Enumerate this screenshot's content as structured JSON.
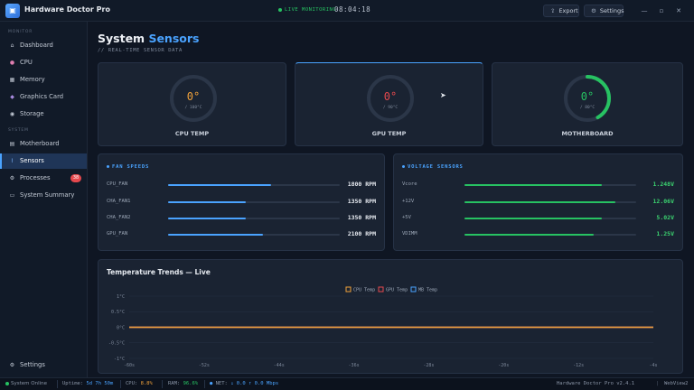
{
  "app": {
    "title": "Hardware Doctor Pro",
    "logo_icon": "chip-icon"
  },
  "titlebar": {
    "live_text": "LIVE MONITORING",
    "clock": "08:04:18",
    "export_label": "Export",
    "settings_label": "Settings"
  },
  "sidebar": {
    "section_monitor": "MONITOR",
    "section_system": "SYSTEM",
    "items": [
      {
        "label": "Dashboard",
        "icon": "house-icon"
      },
      {
        "label": "CPU",
        "icon": "brain-icon"
      },
      {
        "label": "Memory",
        "icon": "memory-icon"
      },
      {
        "label": "Graphics Card",
        "icon": "gamepad-icon"
      },
      {
        "label": "Storage",
        "icon": "disk-icon"
      },
      {
        "label": "Motherboard",
        "icon": "board-icon"
      },
      {
        "label": "Sensors",
        "icon": "thermometer-icon",
        "active": true
      },
      {
        "label": "Processes",
        "icon": "gear-icon",
        "badge": "38"
      },
      {
        "label": "System Summary",
        "icon": "clipboard-icon"
      }
    ],
    "settings_label": "Settings"
  },
  "page": {
    "title_plain": "System",
    "title_accent": "Sensors",
    "subtitle": "// REAL-TIME SENSOR DATA"
  },
  "gauges": [
    {
      "label": "CPU TEMP",
      "value": "0°",
      "max": "/ 100°C",
      "fraction": 0.0,
      "color": "#f0a13a"
    },
    {
      "label": "GPU TEMP",
      "value": "0°",
      "max": "/ 90°C",
      "fraction": 0.0,
      "color": "#e5484d"
    },
    {
      "label": "MOTHERBOARD",
      "value": "0°",
      "max": "/ 80°C",
      "fraction": 0.42,
      "color": "#27c262"
    }
  ],
  "fans": {
    "title": "FAN SPEEDS",
    "rows": [
      {
        "label": "CPU_FAN",
        "value": "1800 RPM",
        "fraction": 0.6
      },
      {
        "label": "CHA_FAN1",
        "value": "1350 RPM",
        "fraction": 0.45
      },
      {
        "label": "CHA_FAN2",
        "value": "1350 RPM",
        "fraction": 0.45
      },
      {
        "label": "GPU_FAN",
        "value": "2100 RPM",
        "fraction": 0.55
      }
    ]
  },
  "voltages": {
    "title": "VOLTAGE SENSORS",
    "rows": [
      {
        "label": "Vcore",
        "value": "1.248V",
        "fraction": 0.8
      },
      {
        "label": "+12V",
        "value": "12.06V",
        "fraction": 0.88
      },
      {
        "label": "+5V",
        "value": "5.02V",
        "fraction": 0.8
      },
      {
        "label": "VDIMM",
        "value": "1.25V",
        "fraction": 0.75
      }
    ]
  },
  "colors": {
    "accent": "#4aa3ff",
    "fan_fill": "#4aa3ff",
    "volt_fill": "#27c262",
    "volt_text": "#3bd16f"
  },
  "chart_data": {
    "type": "line",
    "title": "Temperature Trends — Live",
    "x": [
      "-60s",
      "-52s",
      "-44s",
      "-36s",
      "-28s",
      "-20s",
      "-12s",
      "-4s"
    ],
    "y_ticks": [
      "1°C",
      "0.5°C",
      "0°C",
      "-0.5°C",
      "-1°C"
    ],
    "ylim": [
      -1,
      1
    ],
    "series": [
      {
        "name": "CPU Temp",
        "color": "#f0a13a",
        "values": [
          0,
          0,
          0,
          0,
          0,
          0,
          0,
          0
        ]
      },
      {
        "name": "GPU Temp",
        "color": "#e5484d",
        "values": [
          0,
          0,
          0,
          0,
          0,
          0,
          0,
          0
        ]
      },
      {
        "name": "MB Temp",
        "color": "#4aa3ff",
        "values": [
          0,
          0,
          0,
          0,
          0,
          0,
          0,
          0
        ]
      }
    ],
    "legend": "top-center",
    "grid": true
  },
  "statusbar": {
    "status": "System Online",
    "uptime_label": "Uptime:",
    "uptime_value": "5d 7h 50m",
    "cpu_label": "CPU:",
    "cpu_value": "8.8%",
    "ram_label": "RAM:",
    "ram_value": "96.6%",
    "net_label": "NET:",
    "net_value": "↓ 0.0 ↑ 0.0 Mbps",
    "version": "Hardware Doctor Pro v2.4.1",
    "user": "WebView2"
  }
}
